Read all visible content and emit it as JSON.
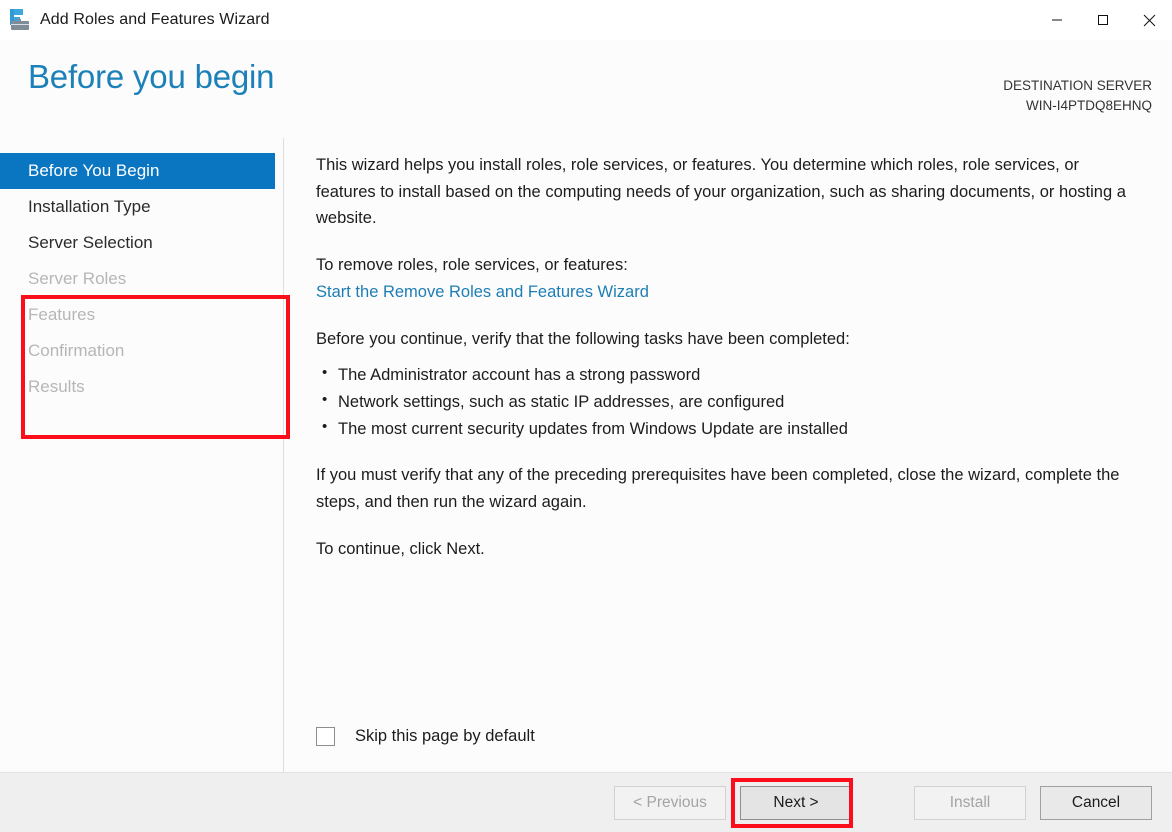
{
  "window": {
    "title": "Add Roles and Features Wizard",
    "icon": "server-toolbox-icon",
    "controls": {
      "minimize": "minimize-icon",
      "maximize": "maximize-icon",
      "close": "close-icon"
    }
  },
  "header": {
    "page_title": "Before you begin",
    "destination_label": "DESTINATION SERVER",
    "destination_value": "WIN-I4PTDQ8EHNQ"
  },
  "nav": {
    "items": [
      {
        "label": "Before You Begin",
        "state": "selected"
      },
      {
        "label": "Installation Type",
        "state": "enabled"
      },
      {
        "label": "Server Selection",
        "state": "enabled"
      },
      {
        "label": "Server Roles",
        "state": "disabled"
      },
      {
        "label": "Features",
        "state": "disabled"
      },
      {
        "label": "Confirmation",
        "state": "disabled"
      },
      {
        "label": "Results",
        "state": "disabled"
      }
    ]
  },
  "content": {
    "intro": "This wizard helps you install roles, role services, or features. You determine which roles, role services, or features to install based on the computing needs of your organization, such as sharing documents, or hosting a website.",
    "remove_heading": "To remove roles, role services, or features:",
    "remove_link": "Start the Remove Roles and Features Wizard",
    "verify_heading": "Before you continue, verify that the following tasks have been completed:",
    "tasks": [
      "The Administrator account has a strong password",
      "Network settings, such as static IP addresses, are configured",
      "The most current security updates from Windows Update are installed"
    ],
    "prereq_note": "If you must verify that any of the preceding prerequisites have been completed, close the wizard, complete the steps, and then run the wizard again.",
    "continue_note": "To continue, click Next.",
    "skip_checkbox_label": "Skip this page by default",
    "skip_checkbox_checked": false
  },
  "footer": {
    "buttons": [
      {
        "label": "< Previous",
        "state": "disabled"
      },
      {
        "label": "Next >",
        "state": "focused"
      },
      {
        "label": "Install",
        "state": "disabled"
      },
      {
        "label": "Cancel",
        "state": "default"
      }
    ]
  },
  "annotations": {
    "highlight_color": "#fc0d1b",
    "nav_highlight_target": "Before You Begin through Server Roles",
    "button_highlight_target": "Next >"
  },
  "colors": {
    "accent_blue": "#0a76c2",
    "title_blue": "#1b81b8",
    "link_blue": "#1d7eb4",
    "footer_bg": "#efefef",
    "highlight_red": "#fc0d1b"
  }
}
